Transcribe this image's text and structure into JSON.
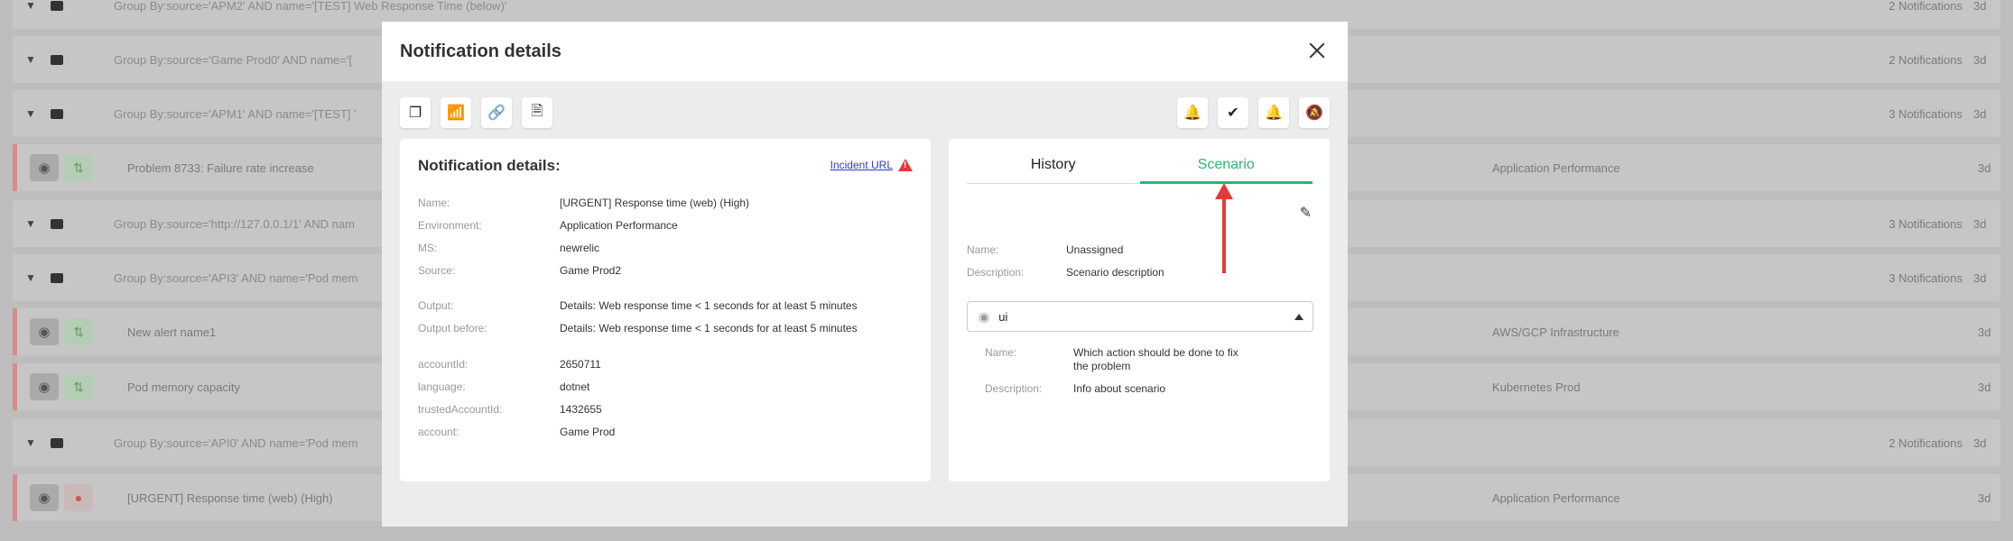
{
  "background": {
    "rows": [
      {
        "type": "group",
        "text": "Group By:source='APM2' AND name='[TEST] Web Response Time (below)'",
        "count": "2 Notifications",
        "age": "3d"
      },
      {
        "type": "group",
        "text": "Group By:source='Game Prod0' AND name='[",
        "count": "2 Notifications",
        "age": "3d"
      },
      {
        "type": "group",
        "text": "Group By:source='APM1' AND name='[TEST] '",
        "count": "3 Notifications",
        "age": "3d"
      },
      {
        "type": "alert",
        "text": "Problem 8733: Failure rate increase",
        "env": "Application Performance",
        "age": "3d"
      },
      {
        "type": "group",
        "text": "Group By:source='http://127.0.0.1/1' AND nam",
        "count": "3 Notifications",
        "age": "3d"
      },
      {
        "type": "group",
        "text": "Group By:source='API3' AND name='Pod mem",
        "count": "3 Notifications",
        "age": "3d"
      },
      {
        "type": "alert",
        "text": "New alert name1",
        "env": "AWS/GCP Infrastructure",
        "age": "3d"
      },
      {
        "type": "alert",
        "text": "Pod memory capacity",
        "env": "Kubernetes Prod",
        "age": "3d"
      },
      {
        "type": "group",
        "text": "Group By:source='API0' AND name='Pod mem",
        "count": "2 Notifications",
        "age": "3d"
      },
      {
        "type": "alert-red",
        "text": "[URGENT] Response time (web) (High)",
        "env": "Application Performance",
        "age": "3d"
      }
    ]
  },
  "modal": {
    "title": "Notification details",
    "toolbar_left": [
      "copy-icon",
      "chart-icon",
      "link-icon",
      "file-icon"
    ],
    "toolbar_right": [
      "bell-plus-icon",
      "check-circle-icon",
      "bell-ring-icon",
      "bell-off-icon"
    ],
    "details": {
      "title": "Notification details:",
      "incident_link": "Incident URL",
      "fields": [
        {
          "k": "Name:",
          "v": "[URGENT] Response time (web) (High)"
        },
        {
          "k": "Environment:",
          "v": "Application Performance"
        },
        {
          "k": "MS:",
          "v": "newrelic"
        },
        {
          "k": "Source:",
          "v": "Game Prod2"
        },
        {
          "k": "Output:",
          "v": "Details: Web response time < 1 seconds for at least 5 minutes"
        },
        {
          "k": "Output before:",
          "v": "Details: Web response time < 1 seconds for at least 5 minutes"
        },
        {
          "k": "accountId:",
          "v": "2650711"
        },
        {
          "k": "language:",
          "v": "dotnet"
        },
        {
          "k": "trustedAccountId:",
          "v": "1432655"
        },
        {
          "k": "account:",
          "v": "Game Prod"
        }
      ]
    },
    "scenario_panel": {
      "tabs": [
        "History",
        "Scenario"
      ],
      "active_tab": "Scenario",
      "name_label": "Name:",
      "name_value": "Unassigned",
      "desc_label": "Description:",
      "desc_value": "Scenario description",
      "select_value": "ui",
      "sub_name_label": "Name:",
      "sub_name_value": "Which action should be done to fix the problem",
      "sub_desc_label": "Description:",
      "sub_desc_value": "Info about scenario"
    }
  },
  "colors": {
    "accent_green": "#2bb673",
    "annotation_red": "#e53935",
    "link_blue": "#2b3ad6"
  }
}
